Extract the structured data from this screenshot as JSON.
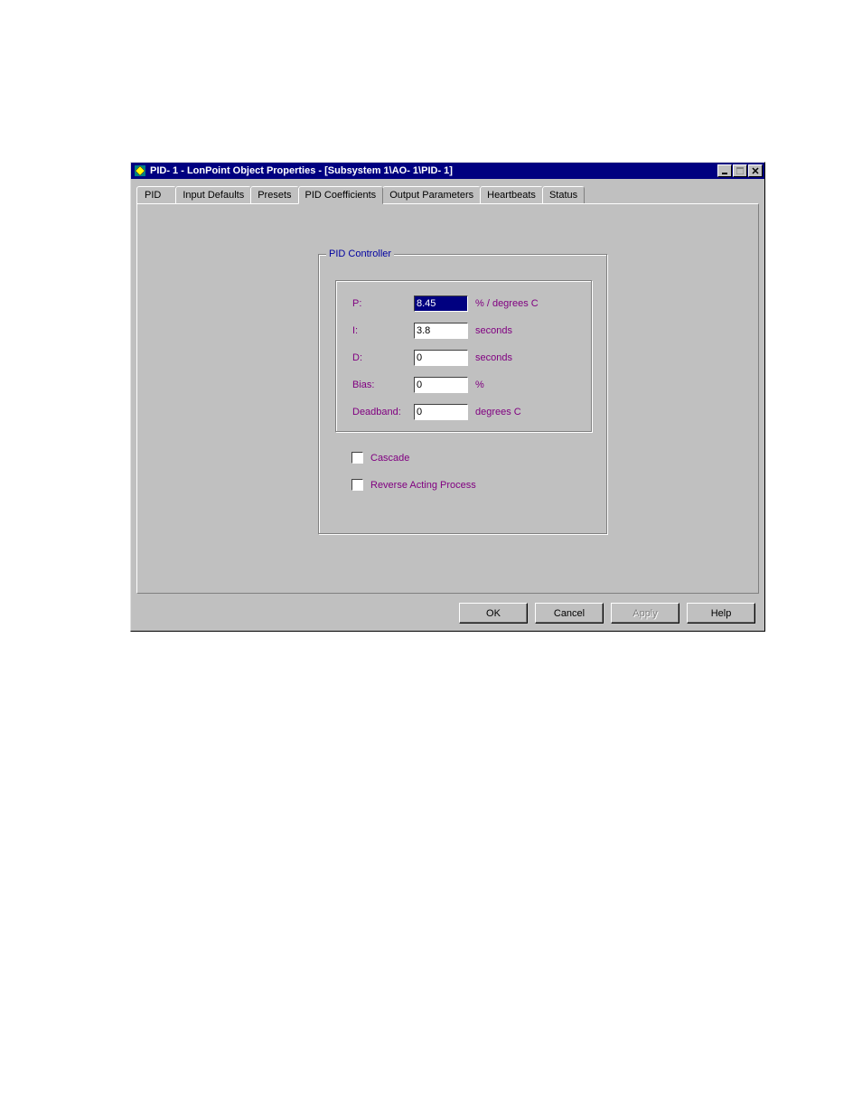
{
  "window": {
    "title": "PID- 1 - LonPoint Object Properties - [Subsystem 1\\AO- 1\\PID- 1]"
  },
  "tabs": [
    {
      "label": "PID"
    },
    {
      "label": "Input Defaults"
    },
    {
      "label": "Presets"
    },
    {
      "label": "PID Coefficients"
    },
    {
      "label": "Output Parameters"
    },
    {
      "label": "Heartbeats"
    },
    {
      "label": "Status"
    }
  ],
  "groupbox": {
    "legend": "PID Controller"
  },
  "fields": {
    "p": {
      "label": "P:",
      "value": "8.45",
      "unit": "% / degrees C"
    },
    "i": {
      "label": "I:",
      "value": "3.8",
      "unit": "seconds"
    },
    "d": {
      "label": "D:",
      "value": "0",
      "unit": "seconds"
    },
    "bias": {
      "label": "Bias:",
      "value": "0",
      "unit": "%"
    },
    "deadband": {
      "label": "Deadband:",
      "value": "0",
      "unit": "degrees C"
    }
  },
  "checkboxes": {
    "cascade": {
      "label": "Cascade"
    },
    "reverse": {
      "label": "Reverse Acting Process"
    }
  },
  "buttons": {
    "ok": "OK",
    "cancel": "Cancel",
    "apply": "Apply",
    "help": "Help"
  }
}
